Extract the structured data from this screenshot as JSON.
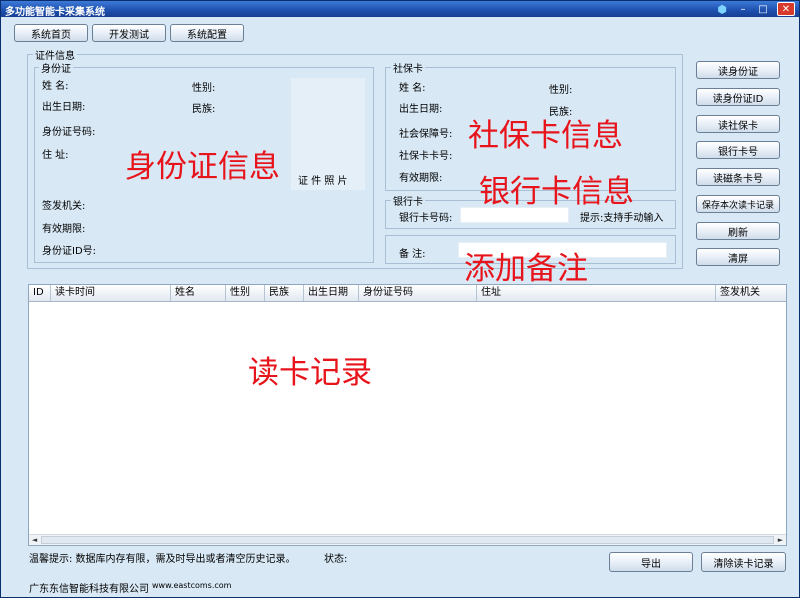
{
  "window": {
    "title": "多功能智能卡采集系统"
  },
  "titlebar_controls": {
    "minimize": "–",
    "maximize": "□",
    "close": "✕"
  },
  "top_tabs": [
    "系统首页",
    "开发测试",
    "系统配置"
  ],
  "cert_info": {
    "legend": "证件信息",
    "id_card": {
      "legend": "身份证",
      "name_label": "姓        名:",
      "gender_label": "性别:",
      "birth_label": "出生日期:",
      "ethnicity_label": "民族:",
      "id_number_label": "身份证号码:",
      "address_label": "住        址:",
      "photo_label": "证 件 照 片",
      "issuer_label": "签发机关:",
      "validity_label": "有效期限:",
      "id_code_label": "身份证ID号:"
    },
    "social_card": {
      "legend": "社保卡",
      "name_label": "姓        名:",
      "gender_label": "性别:",
      "birth_label": "出生日期:",
      "ethnicity_label": "民族:",
      "security_no_label": "社会保障号:",
      "card_no_label": "社保卡卡号:",
      "validity_label": "有效期限:"
    },
    "bank_card": {
      "legend": "银行卡",
      "card_no_label": "银行卡号码:",
      "card_no_value": "",
      "hint": "提示:支持手动输入"
    },
    "remark": {
      "label": "备        注:",
      "value": ""
    }
  },
  "side_buttons": [
    "读身份证",
    "读身份证ID",
    "读社保卡",
    "银行卡号",
    "读磁条卡号",
    "保存本次读卡记录",
    "刷新",
    "清屏"
  ],
  "overlays": {
    "id_card_info": "身份证信息",
    "social_card_info": "社保卡信息",
    "bank_card_info": "银行卡信息",
    "add_remark": "添加备注",
    "read_records": "读卡记录"
  },
  "records_table": {
    "columns": [
      "ID",
      "读卡时间",
      "姓名",
      "性别",
      "民族",
      "出生日期",
      "身份证号码",
      "住址",
      "签发机关"
    ],
    "rows": []
  },
  "scrollbar": {
    "left": "◄",
    "right": "►"
  },
  "footer": {
    "tip": "温馨提示:     数据库内存有限，需及时导出或者清空历史记录。",
    "status_label": "状态:",
    "export_label": "导出",
    "clear_label": "清除读卡记录",
    "company": "广东东信智能科技有限公司",
    "website": "www.eastcoms.com"
  },
  "colors": {
    "accent_red": "#e8141b",
    "titlebar_blue": "#1d4fae",
    "panel_bg": "#d8e8f5"
  }
}
